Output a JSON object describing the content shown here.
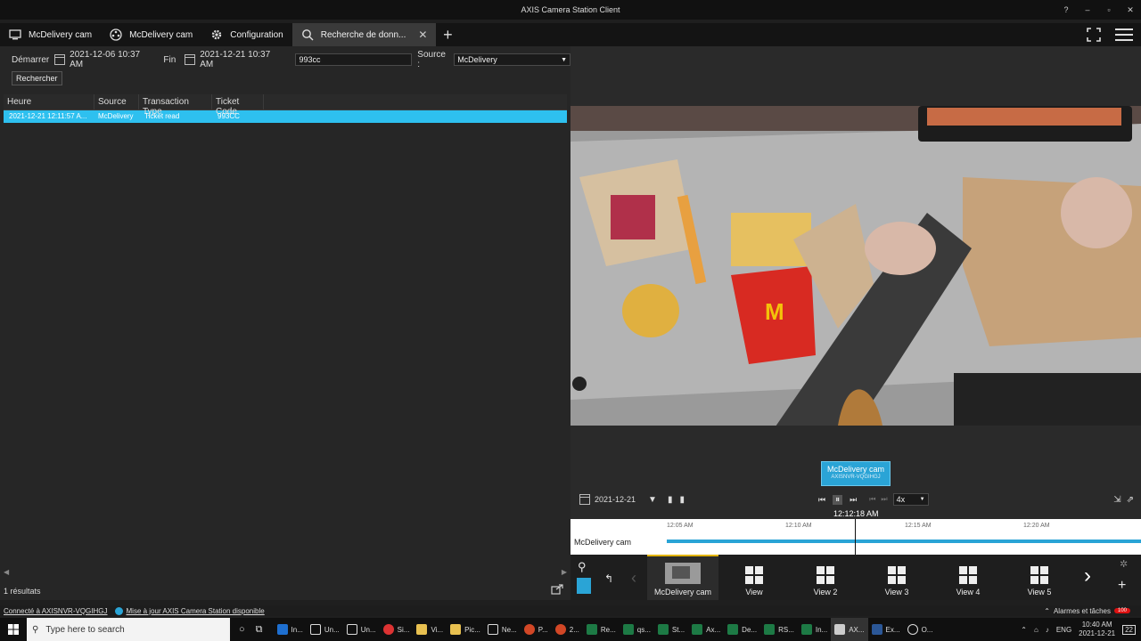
{
  "window": {
    "title": "AXIS Camera Station Client",
    "controls": [
      "?",
      "–",
      "▫",
      "✕"
    ]
  },
  "tabs": [
    {
      "label": "McDelivery cam",
      "icon": "monitor-icon"
    },
    {
      "label": "McDelivery cam",
      "icon": "film-reel-icon"
    },
    {
      "label": "Configuration",
      "icon": "gear-icon"
    },
    {
      "label": "Recherche de donn...",
      "icon": "search-icon",
      "active": true
    }
  ],
  "search": {
    "start_label": "Démarrer",
    "start_value": "2021-12-06 10:37 AM",
    "end_label": "Fin",
    "end_value": "2021-12-21 10:37 AM",
    "query_value": "993cc",
    "source_label": "Source :",
    "source_value": "McDelivery",
    "button_label": "Rechercher"
  },
  "table": {
    "headers": [
      "Heure",
      "Source",
      "Transaction Type",
      "Ticket Code"
    ],
    "rows": [
      [
        "2021-12-21 12:11:57 A...",
        "McDelivery",
        "Ticket read",
        "993CC"
      ]
    ]
  },
  "results_text": "1 résultats",
  "player": {
    "camera_label": "McDelivery cam",
    "camera_sub": "AXISNVR-VQGIHGJ",
    "date": "2021-12-21",
    "speed": "4x",
    "current_time": "12:12:18 AM",
    "timeline_ticks": [
      "12:05 AM",
      "12:10 AM",
      "12:15 AM",
      "12:20 AM"
    ],
    "timeline_row_label": "McDelivery cam"
  },
  "views": [
    {
      "label": "McDelivery cam",
      "active": true
    },
    {
      "label": "View"
    },
    {
      "label": "View 2"
    },
    {
      "label": "View 3"
    },
    {
      "label": "View 4"
    },
    {
      "label": "View 5"
    }
  ],
  "status": {
    "connection": "Connecté à AXISNVR-VQGIHGJ",
    "update": "Mise à jour AXIS Camera Station disponible",
    "alarms": "Alarmes et tâches",
    "alarm_count": "100"
  },
  "taskbar": {
    "search_placeholder": "Type here to search",
    "items": [
      "In...",
      "Un...",
      "Un...",
      "Si...",
      "Vi...",
      "Pic...",
      "Ne...",
      "P...",
      "2...",
      "Re...",
      "qs...",
      "St...",
      "Ax...",
      "De...",
      "RS...",
      "In...",
      "AX...",
      "Ex...",
      "O..."
    ],
    "lang": "ENG",
    "time": "10:40 AM",
    "date": "2021-12-21",
    "notif": "22"
  }
}
